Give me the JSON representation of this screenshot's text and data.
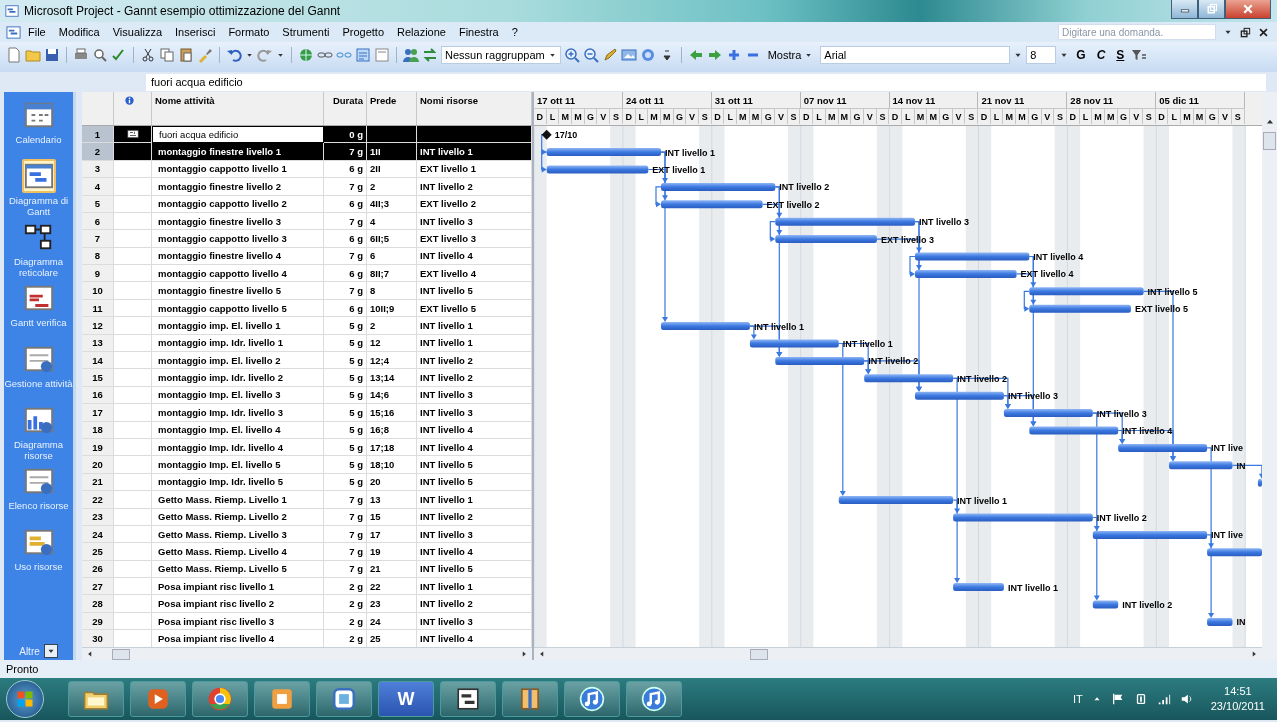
{
  "window": {
    "title": "Microsoft Project - Gannt esempio ottimizzazione del Gannt"
  },
  "menu": [
    "File",
    "Modifica",
    "Visualizza",
    "Inserisci",
    "Formato",
    "Strumenti",
    "Progetto",
    "Relazione",
    "Finestra",
    "?"
  ],
  "help_box": {
    "placeholder": "Digitare una domanda."
  },
  "toolbar": {
    "group_by": "Nessun raggruppam",
    "show": "Mostra",
    "font": "Arial",
    "font_size": "8",
    "format_buttons": [
      "G",
      "C",
      "S"
    ]
  },
  "entry_bar": {
    "value": "fuori acqua edificio"
  },
  "view_bar": {
    "items": [
      {
        "label": "Calendario",
        "kind": "calendar",
        "selected": false
      },
      {
        "label": "Diagramma di Gantt",
        "kind": "gantt",
        "selected": true
      },
      {
        "label": "Diagramma reticolare",
        "kind": "network",
        "selected": false
      },
      {
        "label": "Gantt verifica",
        "kind": "tracking",
        "selected": false
      },
      {
        "label": "Gestione attività",
        "kind": "task",
        "selected": false
      },
      {
        "label": "Diagramma risorse",
        "kind": "graph",
        "selected": false
      },
      {
        "label": "Elenco risorse",
        "kind": "sheet",
        "selected": false
      },
      {
        "label": "Uso risorse",
        "kind": "usage",
        "selected": false
      }
    ],
    "more": "Altre"
  },
  "table": {
    "columns": [
      "Nome attività",
      "Durata",
      "Prede",
      "Nomi risorse"
    ],
    "rows": [
      {
        "id": "1",
        "name": "fuori acqua edificio",
        "duration": "0 g",
        "selected": true,
        "active": true,
        "indicator": true,
        "bar_label": "17/10"
      },
      {
        "id": "2",
        "name": "montaggio finestre livello 1",
        "duration": "7 g",
        "predecessors": "1II",
        "resources": "INT livello 1",
        "selected": true,
        "active": false,
        "indicator": false,
        "bar_label": "INT livello 1"
      },
      {
        "id": "3",
        "name": "montaggio cappotto livello 1",
        "duration": "6 g",
        "predecessors": "2II",
        "resources": "EXT livello 1",
        "selected": false,
        "active": false,
        "indicator": false,
        "bar_label": "EXT livello 1"
      },
      {
        "id": "4",
        "name": "montaggio finestre livello 2",
        "duration": "7 g",
        "predecessors": "2",
        "resources": "INT livello 2",
        "selected": false,
        "active": false,
        "indicator": false,
        "bar_label": "INT livello 2"
      },
      {
        "id": "5",
        "name": "montaggio cappotto livello 2",
        "duration": "6 g",
        "predecessors": "4II;3",
        "resources": "EXT livello 2",
        "selected": false,
        "active": false,
        "indicator": false,
        "bar_label": "EXT livello 2"
      },
      {
        "id": "6",
        "name": "montaggio finestre livello 3",
        "duration": "7 g",
        "predecessors": "4",
        "resources": "INT livello 3",
        "selected": false,
        "active": false,
        "indicator": false,
        "bar_label": "INT livello 3"
      },
      {
        "id": "7",
        "name": "montaggio cappotto livello 3",
        "duration": "6 g",
        "predecessors": "6II;5",
        "resources": "EXT livello 3",
        "selected": false,
        "active": false,
        "indicator": false,
        "bar_label": "EXT livello 3"
      },
      {
        "id": "8",
        "name": "montaggio finestre livello 4",
        "duration": "7 g",
        "predecessors": "6",
        "resources": "INT livello 4",
        "selected": false,
        "active": false,
        "indicator": false,
        "bar_label": "INT livello 4"
      },
      {
        "id": "9",
        "name": "montaggio cappotto livello 4",
        "duration": "6 g",
        "predecessors": "8II;7",
        "resources": "EXT livello 4",
        "selected": false,
        "active": false,
        "indicator": false,
        "bar_label": "EXT livello 4"
      },
      {
        "id": "10",
        "name": "montaggio finestre livello 5",
        "duration": "7 g",
        "predecessors": "8",
        "resources": "INT livello 5",
        "selected": false,
        "active": false,
        "indicator": false,
        "bar_label": "INT livello 5"
      },
      {
        "id": "11",
        "name": "montaggio cappotto livello 5",
        "duration": "6 g",
        "predecessors": "10II;9",
        "resources": "EXT livello 5",
        "selected": false,
        "active": false,
        "indicator": false,
        "bar_label": "EXT livello 5"
      },
      {
        "id": "12",
        "name": "montaggio imp. El. livello 1",
        "duration": "5 g",
        "predecessors": "2",
        "resources": "INT livello 1",
        "selected": false,
        "active": false,
        "indicator": false,
        "bar_label": "INT livello 1"
      },
      {
        "id": "13",
        "name": "montaggio imp. Idr. livello 1",
        "duration": "5 g",
        "predecessors": "12",
        "resources": "INT livello 1",
        "selected": false,
        "active": false,
        "indicator": false,
        "bar_label": "INT livello 1"
      },
      {
        "id": "14",
        "name": "montaggio imp. El. livello 2",
        "duration": "5 g",
        "predecessors": "12;4",
        "resources": "INT livello 2",
        "selected": false,
        "active": false,
        "indicator": false,
        "bar_label": "INT livello 2"
      },
      {
        "id": "15",
        "name": "montaggio imp. Idr. livello 2",
        "duration": "5 g",
        "predecessors": "13;14",
        "resources": "INT livello 2",
        "selected": false,
        "active": false,
        "indicator": false,
        "bar_label": "INT livello 2"
      },
      {
        "id": "16",
        "name": "montaggio Imp. El. livello 3",
        "duration": "5 g",
        "predecessors": "14;6",
        "resources": "INT livello 3",
        "selected": false,
        "active": false,
        "indicator": false,
        "bar_label": "INT livello 3"
      },
      {
        "id": "17",
        "name": "montaggio Imp. Idr. livello 3",
        "duration": "5 g",
        "predecessors": "15;16",
        "resources": "INT livello 3",
        "selected": false,
        "active": false,
        "indicator": false,
        "bar_label": "INT livello 3"
      },
      {
        "id": "18",
        "name": "montaggio Imp. El. livello 4",
        "duration": "5 g",
        "predecessors": "16;8",
        "resources": "INT livello 4",
        "selected": false,
        "active": false,
        "indicator": false,
        "bar_label": "INT livello 4"
      },
      {
        "id": "19",
        "name": "montaggio Imp. Idr. livello 4",
        "duration": "5 g",
        "predecessors": "17;18",
        "resources": "INT livello 4",
        "selected": false,
        "active": false,
        "indicator": false,
        "bar_label": "INT live"
      },
      {
        "id": "20",
        "name": "montaggio Imp. El. livello 5",
        "duration": "5 g",
        "predecessors": "18;10",
        "resources": "INT livello 5",
        "selected": false,
        "active": false,
        "indicator": false,
        "bar_label": "IN"
      },
      {
        "id": "21",
        "name": "montaggio Imp. Idr. livello 5",
        "duration": "5 g",
        "predecessors": "20",
        "resources": "INT livello 5",
        "selected": false,
        "active": false,
        "indicator": false
      },
      {
        "id": "22",
        "name": "Getto Mass. Riemp. Livello 1",
        "duration": "7 g",
        "predecessors": "13",
        "resources": "INT livello 1",
        "selected": false,
        "active": false,
        "indicator": false,
        "bar_label": "INT livello 1"
      },
      {
        "id": "23",
        "name": "Getto Mass. Riemp. Livello 2",
        "duration": "7 g",
        "predecessors": "15",
        "resources": "INT livello 2",
        "selected": false,
        "active": false,
        "indicator": false,
        "bar_label": "INT livello 2"
      },
      {
        "id": "24",
        "name": "Getto Mass. Riemp. Livello 3",
        "duration": "7 g",
        "predecessors": "17",
        "resources": "INT livello 3",
        "selected": false,
        "active": false,
        "indicator": false,
        "bar_label": "INT live"
      },
      {
        "id": "25",
        "name": "Getto Mass. Riemp. Livello 4",
        "duration": "7 g",
        "predecessors": "19",
        "resources": "INT livello 4",
        "selected": false,
        "active": false,
        "indicator": false
      },
      {
        "id": "26",
        "name": "Getto Mass. Riemp. Livello 5",
        "duration": "7 g",
        "predecessors": "21",
        "resources": "INT livello 5",
        "selected": false,
        "active": false,
        "indicator": false
      },
      {
        "id": "27",
        "name": "Posa impiant risc livello 1",
        "duration": "2 g",
        "predecessors": "22",
        "resources": "INT livello 1",
        "selected": false,
        "active": false,
        "indicator": false,
        "bar_label": "INT livello 1"
      },
      {
        "id": "28",
        "name": "Posa impiant risc livello 2",
        "duration": "2 g",
        "predecessors": "23",
        "resources": "INT livello 2",
        "selected": false,
        "active": false,
        "indicator": false,
        "bar_label": "INT livello 2"
      },
      {
        "id": "29",
        "name": "Posa impiant risc livello 3",
        "duration": "2 g",
        "predecessors": "24",
        "resources": "INT livello 3",
        "selected": false,
        "active": false,
        "indicator": false,
        "bar_label": "IN"
      },
      {
        "id": "30",
        "name": "Posa impiant risc livello 4",
        "duration": "2 g",
        "predecessors": "25",
        "resources": "INT livello 4",
        "selected": false,
        "active": false,
        "indicator": false
      }
    ]
  },
  "gantt": {
    "weeks": [
      {
        "label": "17 ott 11",
        "days": [
          "D",
          "L",
          "M",
          "M",
          "G",
          "V",
          "S"
        ]
      },
      {
        "label": "24 ott 11",
        "days": [
          "D",
          "L",
          "M",
          "M",
          "G",
          "V",
          "S"
        ]
      },
      {
        "label": "31 ott 11",
        "days": [
          "D",
          "L",
          "M",
          "M",
          "G",
          "V",
          "S"
        ]
      },
      {
        "label": "07 nov 11",
        "days": [
          "D",
          "L",
          "M",
          "M",
          "G",
          "V",
          "S"
        ]
      },
      {
        "label": "14 nov 11",
        "days": [
          "D",
          "L",
          "M",
          "M",
          "G",
          "V",
          "S"
        ]
      },
      {
        "label": "21 nov 11",
        "days": [
          "D",
          "L",
          "M",
          "M",
          "G",
          "V",
          "S"
        ]
      },
      {
        "label": "28 nov 11",
        "days": [
          "D",
          "L",
          "M",
          "M",
          "G",
          "V",
          "S"
        ]
      },
      {
        "label": "05 dic 11",
        "days": [
          "D",
          "L",
          "M",
          "M",
          "G",
          "V",
          "S"
        ]
      }
    ]
  },
  "status_bar": {
    "text": "Pronto"
  },
  "taskbar": {
    "word_letter": "W",
    "language": "IT",
    "time": "14:51",
    "date": "23/10/2011"
  }
}
